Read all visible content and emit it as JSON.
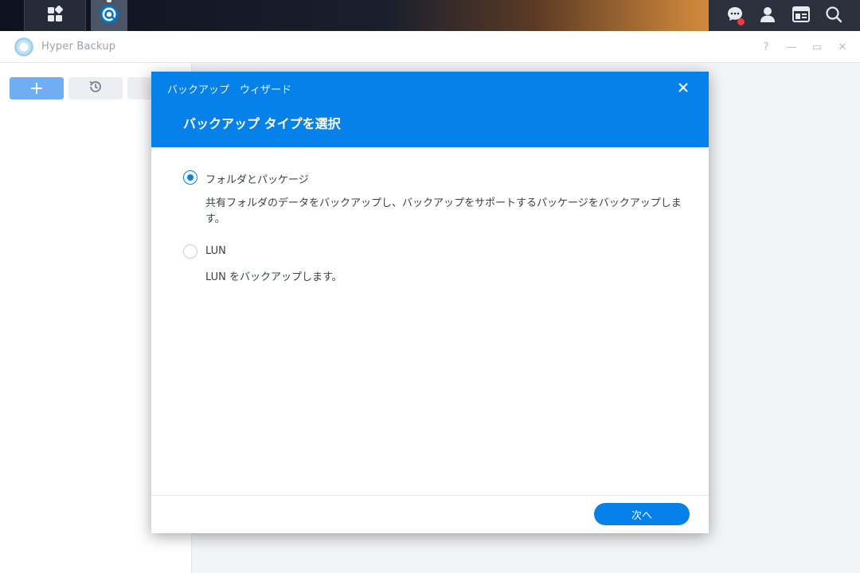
{
  "taskbar": {
    "main_menu_icon": "grid-icon",
    "app_icon": "hyper-backup-icon",
    "right_icons": [
      "chat-icon",
      "user-icon",
      "widget-icon",
      "search-icon"
    ],
    "notification_color": "#f23a3a"
  },
  "window": {
    "title": "Hyper Backup",
    "controls": {
      "help": "?",
      "minimize": "—",
      "maximize": "▭",
      "close": "✕"
    }
  },
  "sidebar": {
    "add_label": "+",
    "history_icon": "history-icon"
  },
  "dialog": {
    "title": "バックアップ　ウィザード",
    "subtitle": "バックアップ タイプを選択",
    "options": [
      {
        "label": "フォルダとパッケージ",
        "description": "共有フォルダのデータをバックアップし、バックアップをサポートするパッケージをバックアップします。",
        "checked": true
      },
      {
        "label": "LUN",
        "description": "LUN をバックアップします。",
        "checked": false
      }
    ],
    "next_label": "次へ",
    "accent_color": "#0781ea"
  }
}
